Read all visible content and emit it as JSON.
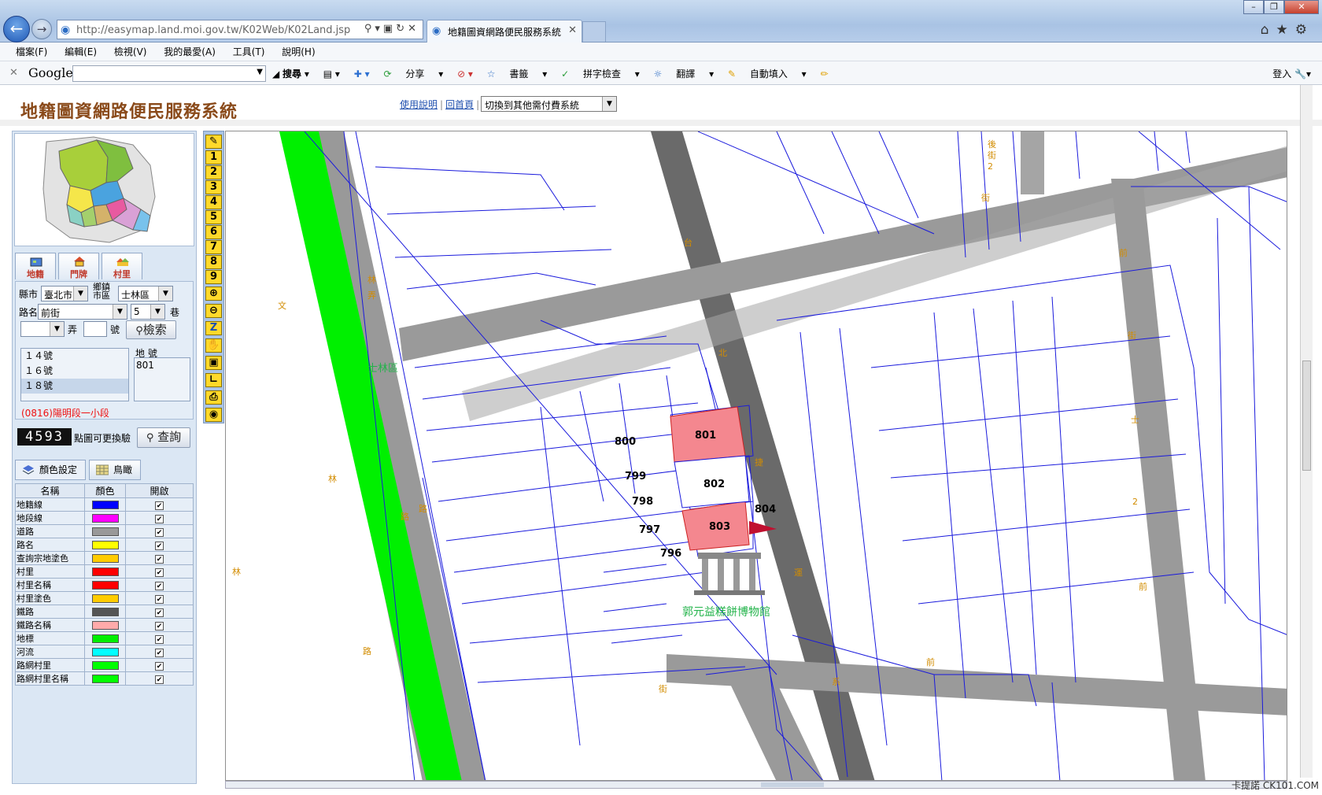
{
  "browser": {
    "url": "http://easymap.land.moi.gov.tw/K02Web/K02Land.jsp",
    "tab_title": "地籍圖資網路便民服務系統",
    "menu": [
      "檔案(F)",
      "編輯(E)",
      "檢視(V)",
      "我的最愛(A)",
      "工具(T)",
      "說明(H)"
    ],
    "google_logo": "Google",
    "google_tools": [
      "搜尋",
      "分享",
      "書籤",
      "拼字檢查",
      "翻譯",
      "自動填入"
    ],
    "login": "登入"
  },
  "page": {
    "title": "地籍圖資網路便民服務系統",
    "link_help": "使用說明",
    "link_home": "回首頁",
    "pay_select": "切換到其他需付費系統"
  },
  "panel": {
    "tabs": [
      "地籍",
      "門牌",
      "村里"
    ],
    "county_label": "縣市",
    "county_value": "臺北市",
    "district_label": "鄉鎮市區",
    "district_value": "士林區",
    "road_label": "路名",
    "road_value": "前街",
    "lane_value": "5",
    "lane_label": "巷",
    "alley_label": "弄",
    "number_label": "號",
    "search_button": "檢索",
    "address_results": [
      "１４號",
      "１６號",
      "１８號"
    ],
    "parcel_header": "地 號",
    "parcel_value": "801",
    "section_text": "(0816)陽明段一小段",
    "captcha": "4593",
    "captcha_note": "點圖可更換驗",
    "query_button": "查詢",
    "color_tab": "顏色設定",
    "bird_tab": "鳥瞰",
    "table_headers": [
      "名稱",
      "顏色",
      "開啟"
    ],
    "layers": [
      {
        "name": "地籍線",
        "color": "#0000ff"
      },
      {
        "name": "地段線",
        "color": "#ff00ff"
      },
      {
        "name": "道路",
        "color": "#999999"
      },
      {
        "name": "路名",
        "color": "#ffff00"
      },
      {
        "name": "查詢宗地塗色",
        "color": "#ffcc00"
      },
      {
        "name": "村里",
        "color": "#ff0000"
      },
      {
        "name": "村里名稱",
        "color": "#ff0000"
      },
      {
        "name": "村里塗色",
        "color": "#ffcc00"
      },
      {
        "name": "鐵路",
        "color": "#555555"
      },
      {
        "name": "鐵路名稱",
        "color": "#ffaaaa"
      },
      {
        "name": "地標",
        "color": "#00ee00"
      },
      {
        "name": "河流",
        "color": "#00ffff"
      },
      {
        "name": "路網村里",
        "color": "#00ff00"
      },
      {
        "name": "路網村里名稱",
        "color": "#00ff00"
      }
    ]
  },
  "toolbar": {
    "numbers": [
      "1",
      "2",
      "3",
      "4",
      "5",
      "6",
      "7",
      "8",
      "9"
    ]
  },
  "map": {
    "parcels": [
      "800",
      "801",
      "802",
      "803",
      "804",
      "799",
      "798",
      "797",
      "796"
    ],
    "landmark": "郭元益糕餅博物館",
    "road_text": [
      "台",
      "北",
      "捷",
      "運",
      "系",
      "林",
      "文",
      "林",
      "路",
      "路",
      "路",
      "林",
      "前",
      "街",
      "前",
      "街",
      "前",
      "街",
      "後",
      "街",
      "2",
      "士",
      "2",
      "弄",
      "士林區"
    ],
    "overlay_label": "士林區"
  },
  "watermark": "卡提諾 CK101.COM"
}
